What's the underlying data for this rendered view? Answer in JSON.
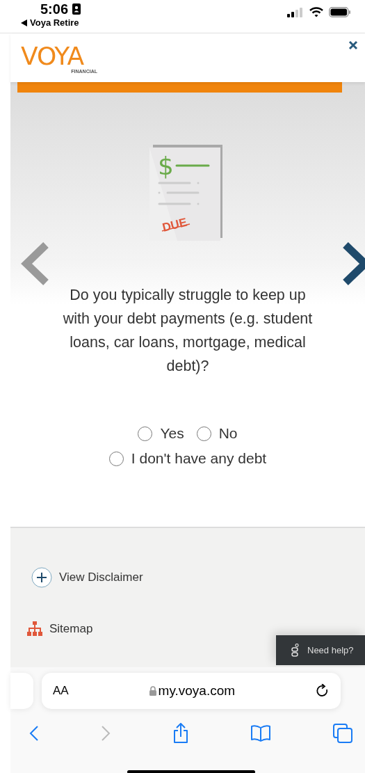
{
  "status_bar": {
    "time": "5:06",
    "back_app": "Voya Retire"
  },
  "header": {
    "logo_wordmark": "VOYA",
    "logo_subtitle": "FINANCIAL",
    "progress": {
      "level": 1
    }
  },
  "illustration": {
    "currency": "$",
    "stamp": "DUE"
  },
  "question": {
    "text": "Do you typically struggle to keep up with your debt payments (e.g. student loans, car loans, mortgage, medical debt)?",
    "options": [
      {
        "label": "Yes",
        "selected": false
      },
      {
        "label": "No",
        "selected": false
      },
      {
        "label": "I don't have any debt",
        "selected": false
      }
    ]
  },
  "footer": {
    "links": [
      {
        "kind": "disclaimer",
        "label": "View Disclaimer"
      },
      {
        "kind": "sitemap",
        "label": "Sitemap"
      }
    ],
    "chat": "Need help?"
  },
  "browser": {
    "text_size": "AA",
    "url": "my.voya.com"
  }
}
